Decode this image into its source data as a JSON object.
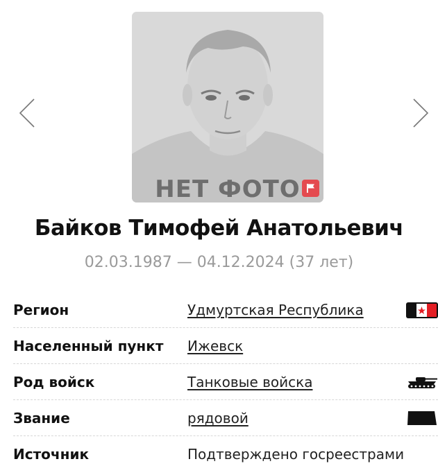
{
  "photo": {
    "no_photo_label": "НЕТ ФОТО",
    "report_icon": "flag-icon",
    "report_color": "#e44a4f"
  },
  "navigation": {
    "prev_icon": "chevron-left-icon",
    "next_icon": "chevron-right-icon"
  },
  "person": {
    "full_name": "Байков Тимофей Анатольевич",
    "dates": "02.03.1987 — 04.12.2024 (37 лет)"
  },
  "details": [
    {
      "label": "Регион",
      "value": "Удмуртская Республика",
      "is_link": true,
      "icon": "udmurtia-flag-icon"
    },
    {
      "label": "Населенный пункт",
      "value": "Ижевск",
      "is_link": true,
      "icon": ""
    },
    {
      "label": "Род войск",
      "value": "Танковые войска",
      "is_link": true,
      "icon": "tank-icon"
    },
    {
      "label": "Звание",
      "value": "рядовой",
      "is_link": true,
      "icon": "rank-insignia-icon"
    },
    {
      "label": "Источник",
      "value": "Подтверждено госреестрами",
      "is_link": false,
      "icon": ""
    }
  ],
  "colors": {
    "text": "#111111",
    "muted": "#9a9a9a",
    "divider": "#d6d6d6"
  }
}
